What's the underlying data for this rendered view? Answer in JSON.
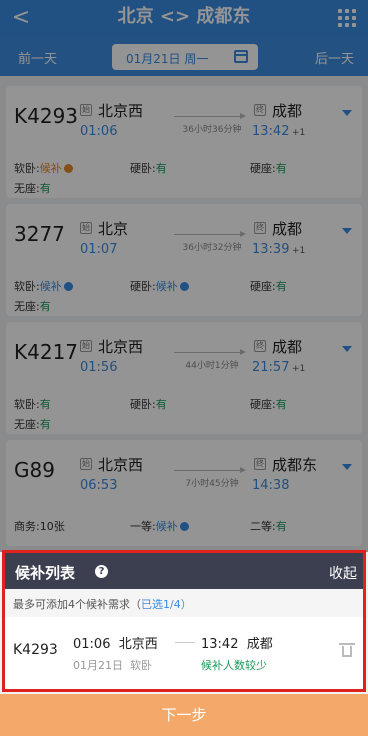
{
  "header": {
    "back": "<",
    "title": "北京 <> 成都东"
  },
  "datebar": {
    "prev": "前一天",
    "date": "01月21日 周一",
    "next": "后一天"
  },
  "trains": [
    {
      "no": "K4293",
      "dep_tag": "始",
      "dep": "北京西",
      "dep_time": "01:06",
      "duration": "36小时36分钟",
      "arr_tag": "终",
      "arr": "成都",
      "arr_time": "13:42",
      "plus": "+1",
      "seats": [
        {
          "label": "软卧:",
          "value": "候补"
        },
        {
          "label": "硬卧:",
          "value": "有"
        },
        {
          "label": "硬座:",
          "value": "有"
        },
        {
          "label": "无座:",
          "value": "有"
        }
      ]
    },
    {
      "no": "3277",
      "dep_tag": "始",
      "dep": "北京",
      "dep_time": "01:07",
      "duration": "36小时32分钟",
      "arr_tag": "终",
      "arr": "成都",
      "arr_time": "13:39",
      "plus": "+1",
      "seats": [
        {
          "label": "软卧:",
          "value": "候补"
        },
        {
          "label": "硬卧:",
          "value": "候补"
        },
        {
          "label": "硬座:",
          "value": "有"
        },
        {
          "label": "无座:",
          "value": "有"
        }
      ]
    },
    {
      "no": "K4217",
      "dep_tag": "始",
      "dep": "北京西",
      "dep_time": "01:56",
      "duration": "44小时1分钟",
      "arr_tag": "终",
      "arr": "成都",
      "arr_time": "21:57",
      "plus": "+1",
      "seats": [
        {
          "label": "软卧:",
          "value": "有"
        },
        {
          "label": "硬卧:",
          "value": "有"
        },
        {
          "label": "硬座:",
          "value": "有"
        },
        {
          "label": "无座:",
          "value": "有"
        }
      ]
    },
    {
      "no": "G89",
      "dep_tag": "始",
      "dep": "北京西",
      "dep_time": "06:53",
      "duration": "7小时45分钟",
      "arr_tag": "终",
      "arr": "成都东",
      "arr_time": "14:38",
      "plus": "",
      "seats": [
        {
          "label": "商务:",
          "value": "10张"
        },
        {
          "label": "一等:",
          "value": "候补"
        },
        {
          "label": "二等:",
          "value": "有"
        }
      ]
    }
  ],
  "waitlist": {
    "title": "候补列表",
    "help": "?",
    "collapse": "收起",
    "note_prefix": "最多可添加4个候补需求（",
    "note_selected": "已选1/4",
    "note_suffix": "）",
    "item": {
      "no": "K4293",
      "dep_time": "01:06",
      "dep": "北京西",
      "arr_time": "13:42",
      "arr": "成都",
      "date": "01月21日",
      "seat": "软卧",
      "status": "候补人数较少"
    }
  },
  "next": "下一步",
  "colors": {
    "primary": "#3a8be0",
    "waitlist_header": "#3b3f4f",
    "highlight_border": "#e0221e",
    "next_button": "#f4a96a",
    "available": "#1a9a5a"
  }
}
